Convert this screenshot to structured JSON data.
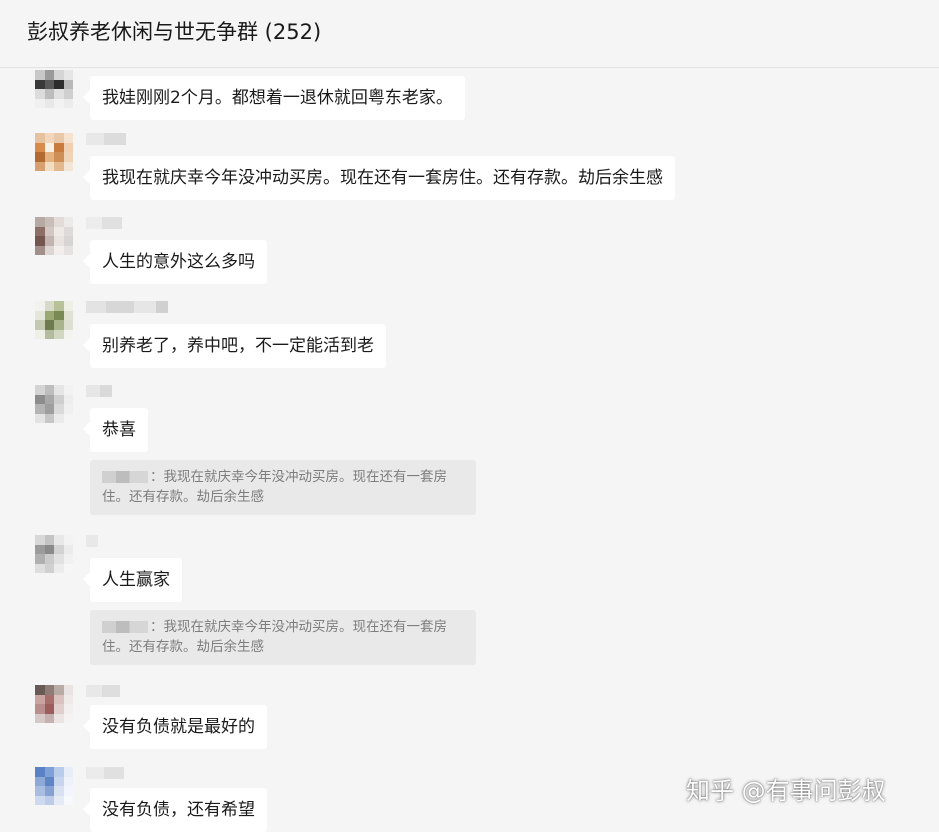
{
  "window": {
    "title": "彭叔养老休闲与世无争群 (252)"
  },
  "messages": [
    {
      "text": "我娃刚刚2个月。都想着一退休就回粤东老家。"
    },
    {
      "text": "我现在就庆幸今年没冲动买房。现在还有一套房住。还有存款。劫后余生感"
    },
    {
      "text": "人生的意外这么多吗"
    },
    {
      "text": "别养老了，养中吧，不一定能活到老"
    },
    {
      "text": "恭喜",
      "quote": "：我现在就庆幸今年没冲动买房。现在还有一套房住。还有存款。劫后余生感"
    },
    {
      "text": "人生赢家",
      "quote": "：我现在就庆幸今年没冲动买房。现在还有一套房住。还有存款。劫后余生感"
    },
    {
      "text": "没有负债就是最好的"
    },
    {
      "text": "没有负债，还有希望"
    }
  ],
  "watermark": "知乎 @有事问彭叔",
  "avatars": [
    [
      "#c8c8c8",
      "#9a9a9a",
      "#d5d5d5",
      "#e6e6e6",
      "#3a3a3a",
      "#5a5a5a",
      "#2d2d2d",
      "#b8b8b8",
      "#dcdcdc",
      "#bcbcbc",
      "#e0e0e0",
      "#cfcfcf",
      "#f0f0f0",
      "#e8e8e8",
      "#f2f2f2",
      "#ececec"
    ],
    [
      "#e6c3a0",
      "#f2d7bd",
      "#e8c8a8",
      "#f5e3d0",
      "#d88a4a",
      "#f6f0e8",
      "#c97a3d",
      "#f0d0b0",
      "#b26a33",
      "#e4b27e",
      "#cf8e55",
      "#efd4b6",
      "#d7a070",
      "#f1dcc4",
      "#e2b88c",
      "#f4e6d6"
    ],
    [
      "#b7a9a4",
      "#c9bdb8",
      "#e2dbd7",
      "#ecebea",
      "#8e6f68",
      "#d4c6c0",
      "#efe9e5",
      "#dedad8",
      "#735650",
      "#c2b4ae",
      "#e9e3df",
      "#d8d4d2",
      "#a38f89",
      "#ddd5d1",
      "#f1eeec",
      "#e5e2e0"
    ],
    [
      "#f2f2f0",
      "#d7dac8",
      "#b8c29a",
      "#eef0e6",
      "#e4e6da",
      "#9aa873",
      "#7a8a55",
      "#e0e3d4",
      "#c4c9b3",
      "#6d7a4e",
      "#a9b38c",
      "#dde0d0",
      "#eef0e8",
      "#b4bca0",
      "#d2d7c2",
      "#f3f4ef"
    ],
    [
      "#d4d4d4",
      "#bdbdbd",
      "#e5e5e5",
      "#f2f2f2",
      "#8c8c8c",
      "#a8a8a8",
      "#cfcfcf",
      "#ededed",
      "#b4b4b4",
      "#9e9e9e",
      "#dadada",
      "#f0f0f0",
      "#e3e3e3",
      "#c6c6c6",
      "#eaeaea",
      "#f5f5f5"
    ],
    [
      "#d8d8d8",
      "#c4c4c4",
      "#e8e8e8",
      "#f3f3f3",
      "#9b9b9b",
      "#8a8a8a",
      "#d2d2d2",
      "#ebebeb",
      "#b0b0b0",
      "#cbcbcb",
      "#e1e1e1",
      "#f1f1f1",
      "#dedede",
      "#d0d0d0",
      "#ececec",
      "#f6f6f6"
    ],
    [
      "#6a5a55",
      "#8d7b75",
      "#b8aaa5",
      "#e9e4e2",
      "#c9a3a0",
      "#a86e6b",
      "#d9c2c0",
      "#efeae8",
      "#b88f8c",
      "#9c5e5a",
      "#e0cfcd",
      "#f2efee",
      "#d6c8c6",
      "#c4b0ae",
      "#ebe4e3",
      "#f5f3f2"
    ],
    [
      "#5b82c4",
      "#7ea0d6",
      "#b9cce9",
      "#e8eef8",
      "#8fa9d6",
      "#5f85c6",
      "#c7d5ee",
      "#eef2f9",
      "#a8bddf",
      "#86a2d3",
      "#d7e1f2",
      "#f2f5fb",
      "#cdd9ee",
      "#bccbe8",
      "#e5ebf6",
      "#f6f8fc"
    ]
  ]
}
